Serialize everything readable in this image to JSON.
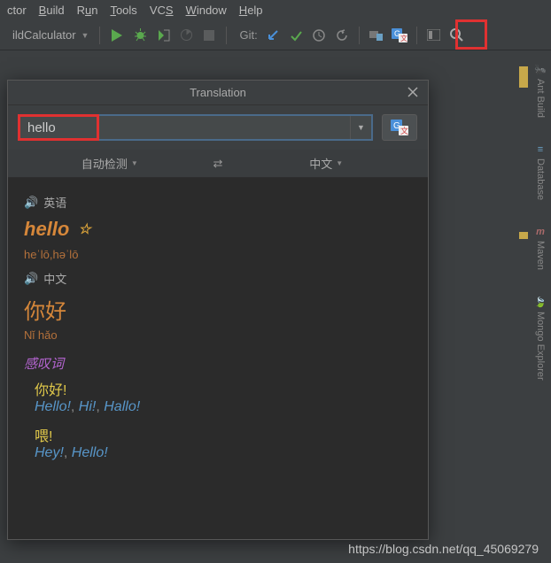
{
  "menu": [
    "ctor",
    "Build",
    "Run",
    "Tools",
    "VCS",
    "Window",
    "Help"
  ],
  "config": {
    "name": "ildCalculator"
  },
  "toolbar": {
    "gitLabel": "Git:"
  },
  "rightTools": [
    {
      "icon": "🐜",
      "label": "Ant Build",
      "color": "#888"
    },
    {
      "icon": "≡",
      "label": "Database",
      "color": "#6aa0c4"
    },
    {
      "icon": "m",
      "label": "Maven",
      "color": "#8a5a5a",
      "bold": true
    },
    {
      "icon": "●",
      "label": "Mongo Explorer",
      "color": "#5aa84e"
    }
  ],
  "popup": {
    "title": "Translation",
    "input": "hello",
    "langFrom": "自动检测",
    "langTo": "中文",
    "srcHeader": "英语",
    "word": "hello",
    "phonetic": "heˈlō,həˈlō",
    "tgtHeader": "中文",
    "cnWord": "你好",
    "pinyin": "Nǐ hǎo",
    "pos": "感叹词",
    "defs": [
      {
        "cn": "你好!",
        "en": [
          "Hello!",
          "Hi!",
          "Hallo!"
        ]
      },
      {
        "cn": "喂!",
        "en": [
          "Hey!",
          "Hello!"
        ]
      }
    ]
  },
  "watermark": "https://blog.csdn.net/qq_45069279"
}
